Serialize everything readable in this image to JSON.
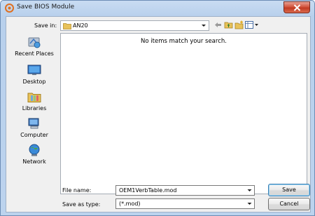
{
  "window": {
    "title": "Save BIOS Module"
  },
  "save_in": {
    "label": "Save in:",
    "value": "AN20"
  },
  "places": [
    {
      "label": "Recent Places",
      "icon": "recent-places-icon"
    },
    {
      "label": "Desktop",
      "icon": "desktop-icon"
    },
    {
      "label": "Libraries",
      "icon": "libraries-icon"
    },
    {
      "label": "Computer",
      "icon": "computer-icon"
    },
    {
      "label": "Network",
      "icon": "network-icon"
    }
  ],
  "file_list": {
    "empty_message": "No items match your search."
  },
  "file_name": {
    "label": "File name:",
    "value": "OEM1VerbTable.mod"
  },
  "save_as_type": {
    "label": "Save as type:",
    "value": "(*.mod)"
  },
  "buttons": {
    "save": "Save",
    "cancel": "Cancel"
  },
  "colors": {
    "title_bar": "#b8d0ec",
    "close_button": "#c23a22",
    "dialog_bg": "#f0f0f0",
    "default_button_border": "#3c7fb1"
  }
}
